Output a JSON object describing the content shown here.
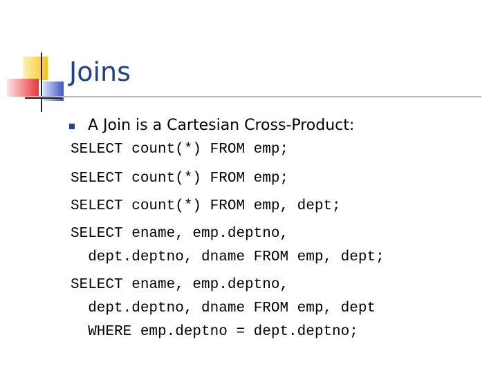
{
  "slide": {
    "title": "Joins",
    "bullet": "A Join is a Cartesian Cross-Product:",
    "code_lines": [
      "SELECT count(*) FROM emp;",
      "SELECT count(*) FROM emp;",
      "SELECT count(*) FROM emp, dept;",
      "SELECT ename, emp.deptno,",
      "  dept.deptno, dname FROM emp, dept;",
      "SELECT ename, emp.deptno,",
      "  dept.deptno, dname FROM emp, dept",
      "  WHERE emp.deptno = dept.deptno;"
    ]
  },
  "colors": {
    "title": "#1f3f8f",
    "bullet_marker": "#1f3f8f",
    "rule": "#b8b8b8",
    "logo_yellow": "#f7c21e",
    "logo_red": "#e8373b",
    "logo_blue": "#3b57c4"
  }
}
